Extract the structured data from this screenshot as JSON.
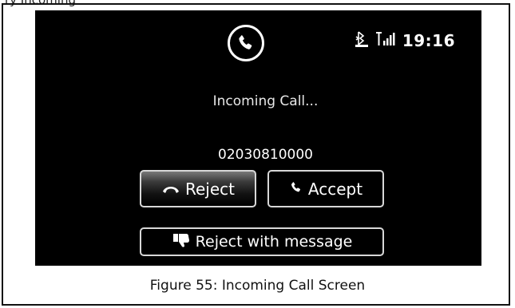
{
  "header_fragment": "ry  Incoming",
  "status": {
    "time": "19:16"
  },
  "call": {
    "title": "Incoming Call...",
    "number": "02030810000"
  },
  "buttons": {
    "reject": "Reject",
    "accept": "Accept",
    "reject_with_message": "Reject with message"
  },
  "caption": "Figure 55: Incoming Call Screen",
  "colors": {
    "screen_bg": "#000000",
    "text": "#ffffff",
    "border": "#d8d8d8"
  }
}
